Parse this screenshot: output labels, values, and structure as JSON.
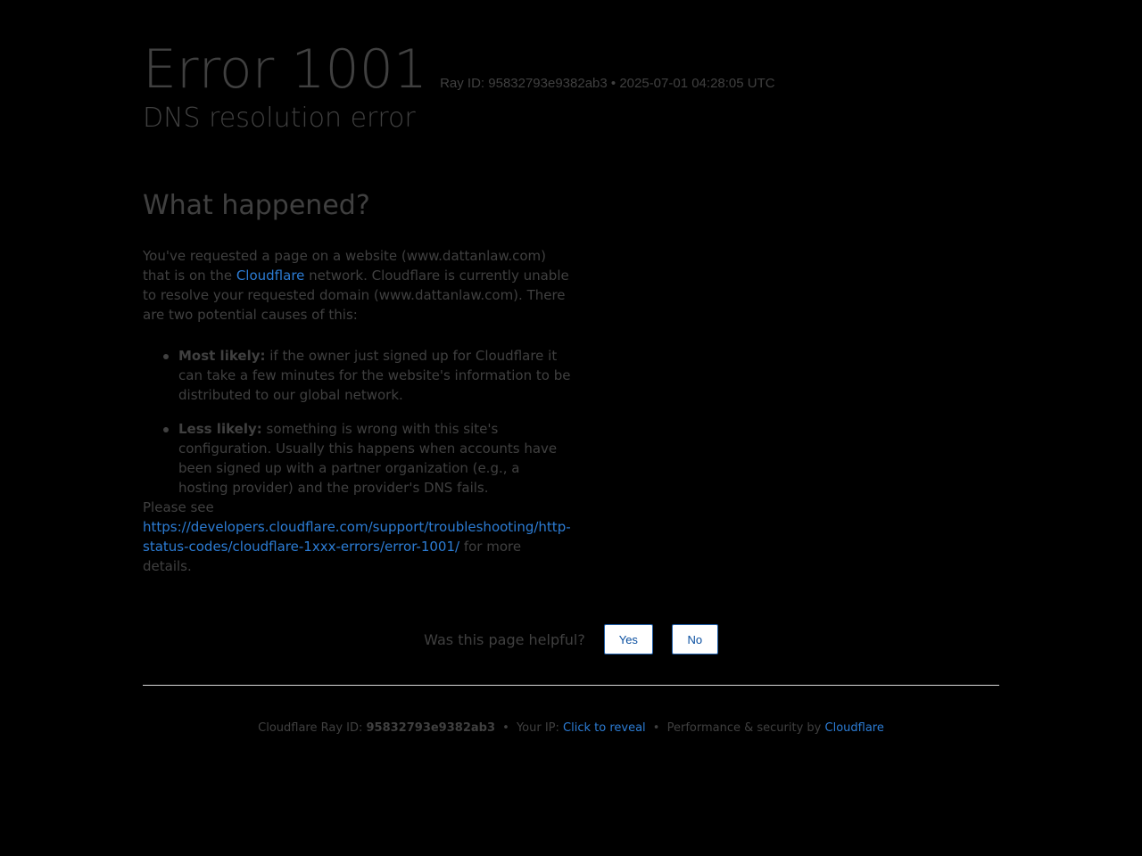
{
  "header": {
    "error_code": "Error 1001",
    "ray_line": "Ray ID: 95832793e9382ab3 • 2025-07-01 04:28:05 UTC",
    "subtitle": "DNS resolution error"
  },
  "main": {
    "heading": "What happened?",
    "intro_part1": "You've requested a page on a website (www.dattanlaw.com) that is on the ",
    "intro_link": "Cloudflare",
    "intro_part2": " network. Cloudflare is currently unable to resolve your requested domain (www.dattanlaw.com). There are two potential causes of this:",
    "causes": [
      {
        "label": "Most likely:",
        "text": " if the owner just signed up for Cloudflare it can take a few minutes for the website's information to be distributed to our global network."
      },
      {
        "label": "Less likely:",
        "text": " something is wrong with this site's configuration. Usually this happens when accounts have been signed up with a partner organization (e.g., a hosting provider) and the provider's DNS fails."
      }
    ],
    "see_prefix": "Please see ",
    "see_link": "https://developers.cloudflare.com/support/troubleshooting/http-status-codes/cloudflare-1xxx-errors/error-1001/",
    "see_suffix": " for more details."
  },
  "feedback": {
    "question": "Was this page helpful?",
    "yes_label": "Yes",
    "no_label": "No"
  },
  "footer": {
    "ray_label": "Cloudflare Ray ID: ",
    "ray_id": "95832793e9382ab3",
    "sep": "•",
    "ip_label": "Your IP: ",
    "ip_link": "Click to reveal",
    "perf_label": "Performance & security by ",
    "perf_link": "Cloudflare"
  },
  "colors": {
    "background": "#000000",
    "text": "#404040",
    "link": "#2c7cd4",
    "button_border": "#1f5ea8"
  }
}
